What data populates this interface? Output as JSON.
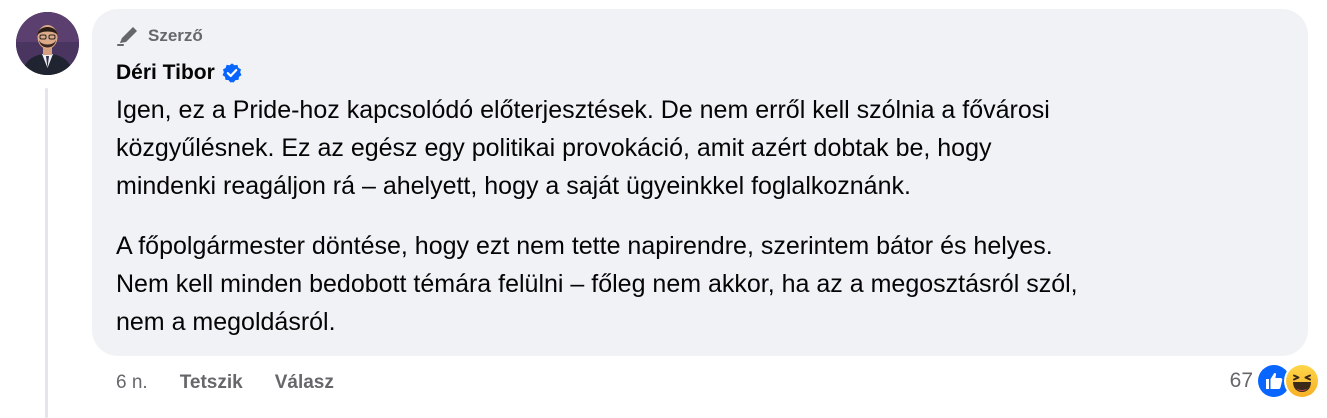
{
  "comment": {
    "author_badge": "Szerző",
    "author_name": "Déri Tibor",
    "paragraphs": [
      {
        "lines": [
          "Igen, ez a Pride-hoz kapcsolódó előterjesztések. De nem erről kell szólnia a fővárosi",
          "közgyűlésnek. Ez az egész egy politikai provokáció, amit azért dobtak be, hogy",
          "mindenki reagáljon rá – ahelyett, hogy a saját ügyeinkkel foglalkoznánk."
        ]
      },
      {
        "lines": [
          "A főpolgármester döntése, hogy ezt nem tette napirendre, szerintem bátor és helyes.",
          "Nem kell minden bedobott témára felülni – főleg nem akkor, ha az a megosztásról szól,",
          "nem a megoldásról."
        ]
      }
    ]
  },
  "actions": {
    "time": "6 n.",
    "like_label": "Tetszik",
    "reply_label": "Válasz"
  },
  "reactions": {
    "count": "67",
    "icons": [
      "like-reaction-icon",
      "haha-reaction-icon"
    ]
  },
  "colors": {
    "bubble_bg": "#f0f2f5",
    "secondary_text": "#65676b",
    "verified_blue": "#0866ff",
    "thread_line": "#e4e6eb"
  }
}
